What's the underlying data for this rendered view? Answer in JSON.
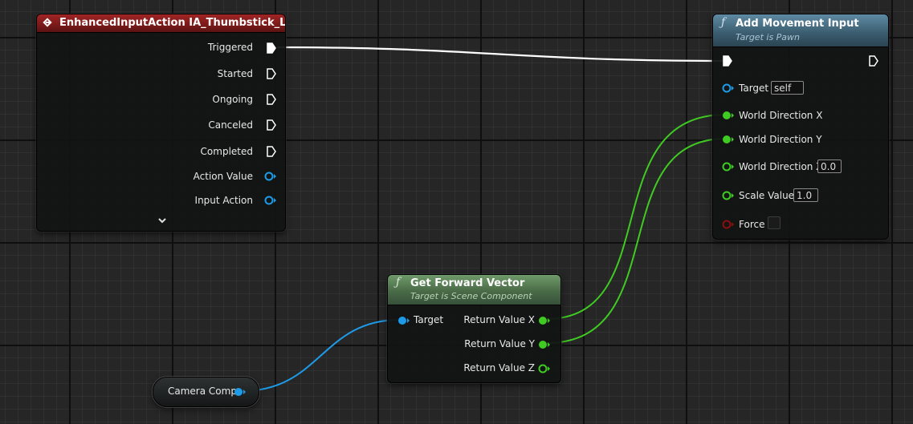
{
  "input_event_node": {
    "icon": "event-diamond-icon",
    "title": "EnhancedInputAction IA_Thumbstick_L",
    "exec_pins": [
      "Triggered",
      "Started",
      "Ongoing",
      "Canceled",
      "Completed"
    ],
    "data_pins": [
      "Action Value",
      "Input Action"
    ],
    "expand_icon": "chevron-down-icon",
    "header_color": "#7a1a1a"
  },
  "add_movement_node": {
    "icon": "function-icon",
    "function_glyph": "ƒ",
    "title": "Add Movement Input",
    "subtitle": "Target is Pawn",
    "header_color": "#3d5f72",
    "pins": {
      "target_label": "Target",
      "target_value": "self",
      "world_direction_x": "World Direction X",
      "world_direction_y": "World Direction Y",
      "world_direction_z": "World Direction Z",
      "world_direction_z_value": "0.0",
      "scale_value_label": "Scale Value",
      "scale_value": "1.0",
      "force_label": "Force",
      "force_checked": false
    }
  },
  "forward_vector_node": {
    "icon": "function-icon",
    "function_glyph": "ƒ",
    "title": "Get Forward Vector",
    "subtitle": "Target is Scene Component",
    "header_color": "#4a6b47",
    "input_label": "Target",
    "outputs": [
      "Return Value X",
      "Return Value Y",
      "Return Value Z"
    ]
  },
  "camera_node": {
    "label": "Camera Comp"
  },
  "colors": {
    "exec": "#ffffff",
    "object": "#1e9be8",
    "float": "#3fcb22",
    "bool": "#8a1010"
  }
}
